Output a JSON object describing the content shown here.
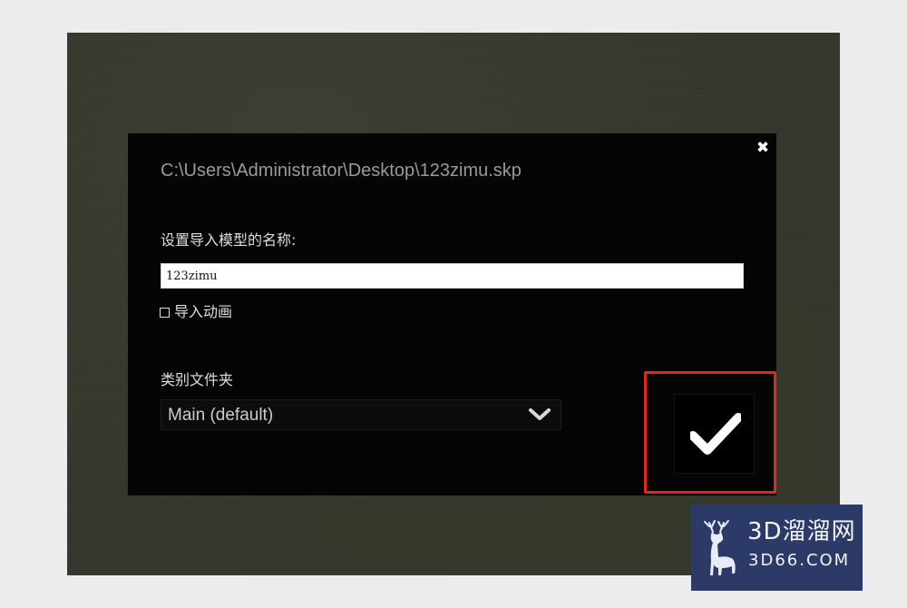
{
  "dialog": {
    "file_path": "C:\\Users\\Administrator\\Desktop\\123zimu.skp",
    "close_icon": "close-icon",
    "close_glyph": "✖",
    "name_label": "设置导入模型的名称:",
    "name_value": "123zimu",
    "import_animation_label": "导入动画",
    "import_animation_checked": false,
    "folder_label": "类别文件夹",
    "folder_selected": "Main (default)",
    "folder_dropdown_icon": "chevron-down-icon",
    "confirm_icon": "checkmark-icon"
  },
  "annotation": {
    "highlight_color": "#e1271f"
  },
  "watermark": {
    "title": "3D溜溜网",
    "subtitle": "3D66.COM",
    "logo_icon": "deer-logo-icon",
    "background_color": "#2c3a68"
  },
  "colors": {
    "dialog_bg": "#050505",
    "viewport_bg": "#34372c",
    "page_bg": "#ececec"
  }
}
